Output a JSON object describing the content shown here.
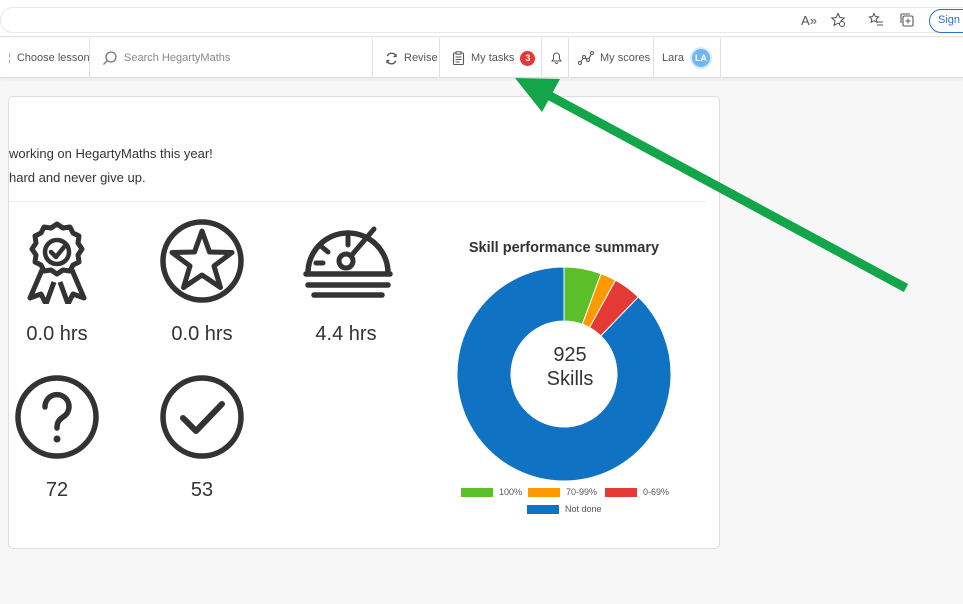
{
  "browser": {
    "read_aloud_icon": "A»",
    "signin_label": "Sign i"
  },
  "nav": {
    "choose_lesson": "Choose lesson",
    "search_placeholder": "Search HegartyMaths",
    "revise": "Revise",
    "my_tasks": "My tasks",
    "tasks_count": "3",
    "my_scores": "My scores",
    "user_name": "Lara",
    "user_initials": "LA"
  },
  "card": {
    "line1": "working on HegartyMaths this year!",
    "line2": "hard and never give up.",
    "stats": [
      {
        "icon": "award-ribbon-icon",
        "value": "0.0 hrs"
      },
      {
        "icon": "star-circle-icon",
        "value": "0.0 hrs"
      },
      {
        "icon": "speedometer-icon",
        "value": "4.4 hrs"
      },
      {
        "icon": "question-circle-icon",
        "value": "72"
      },
      {
        "icon": "check-circle-icon",
        "value": "53"
      }
    ]
  },
  "chart_data": {
    "type": "pie",
    "title": "Skill performance summary",
    "center_value": "925",
    "center_label": "Skills",
    "categories": [
      "100%",
      "70-99%",
      "0-69%",
      "Not done"
    ],
    "values": [
      52,
      22,
      39,
      812
    ],
    "colors": [
      "#5bbf2a",
      "#ff9900",
      "#e53935",
      "#0f72c2"
    ]
  },
  "colors": {
    "accent": "#0f72c2",
    "arrow": "#13a54a",
    "badge": "#e53935"
  }
}
